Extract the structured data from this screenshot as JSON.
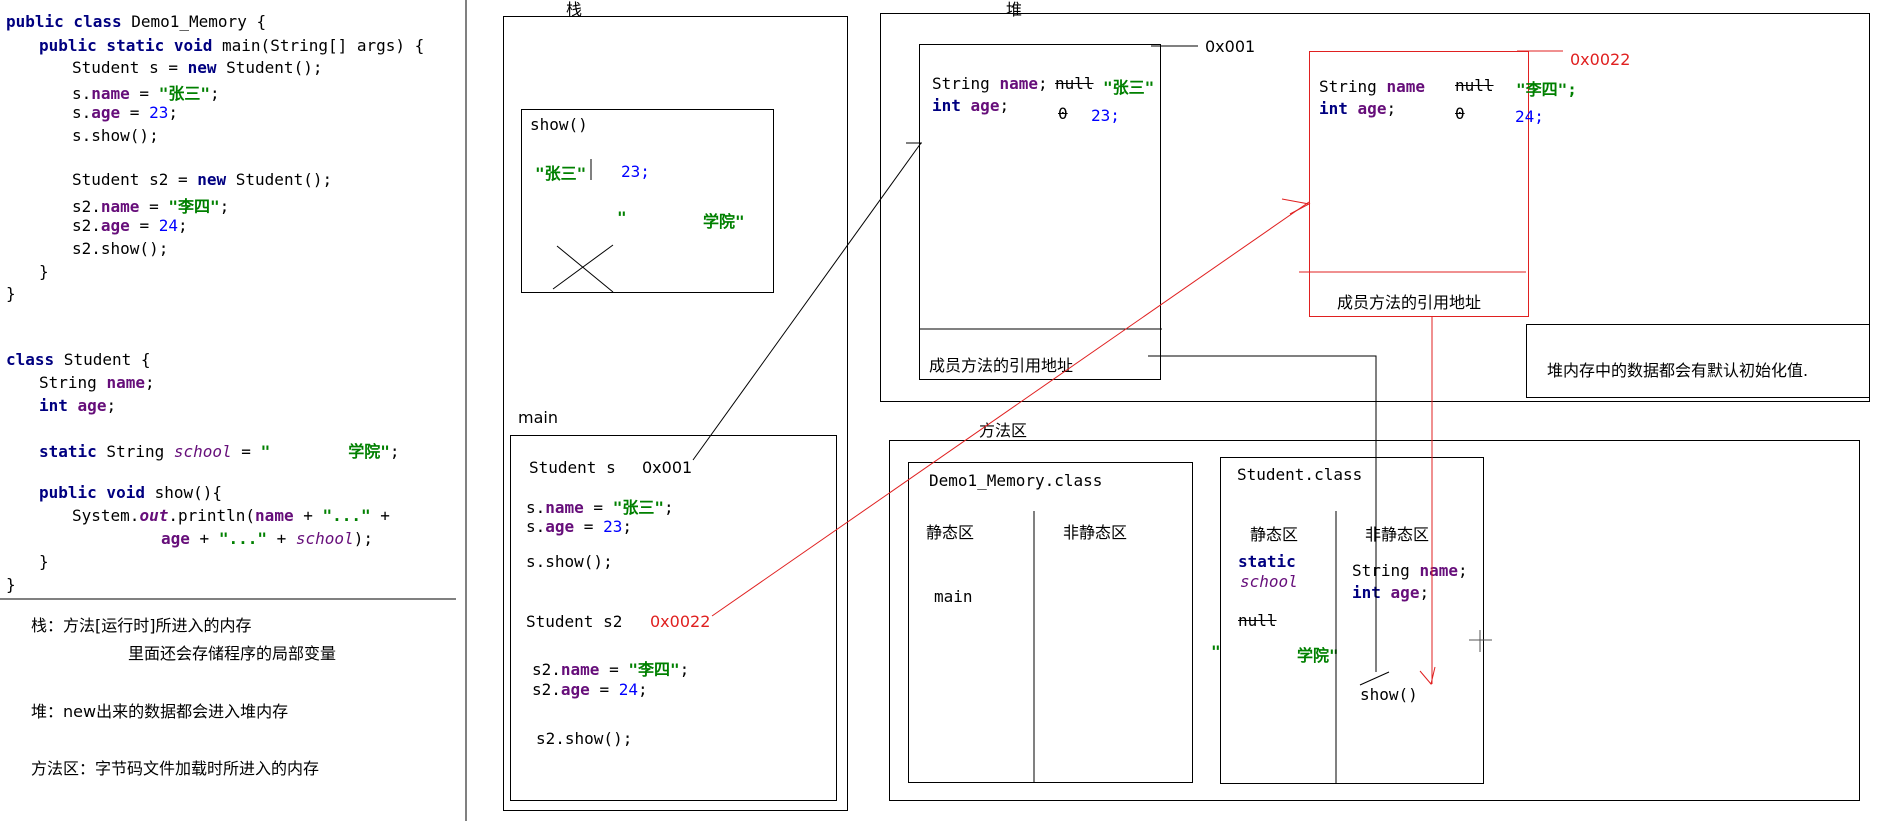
{
  "code": {
    "l1_kw": "public class",
    "l1_rest": " Demo1_Memory {",
    "l2_kw": "public static void",
    "l2_rest": " main(String[] args) {",
    "l3_a": "Student s = ",
    "l3_kw": "new",
    "l3_b": " Student();",
    "l4_a": "s.",
    "l4_fld": "name",
    "l4_b": " = ",
    "l4_str": "\"张三\"",
    "l4_c": ";",
    "l5_a": "s.",
    "l5_fld": "age",
    "l5_b": " = ",
    "l5_num": "23",
    "l5_c": ";",
    "l6": "s.show();",
    "l7_a": "Student s2 = ",
    "l7_kw": "new",
    "l7_b": " Student();",
    "l8_a": "s2.",
    "l8_fld": "name",
    "l8_b": " = ",
    "l8_str": "\"李四\"",
    "l8_c": ";",
    "l9_a": "s2.",
    "l9_fld": "age",
    "l9_b": " = ",
    "l9_num": "24",
    "l9_c": ";",
    "l10": "s2.show();",
    "close1": "}",
    "close2": "}",
    "c1_kw": "class",
    "c1_rest": " Student {",
    "c2_a": "String ",
    "c2_fld": "name",
    "c2_b": ";",
    "c3_kw": "int",
    "c3_sp": " ",
    "c3_fld": "age",
    "c3_b": ";",
    "c4_kw": "static",
    "c4_a": " String ",
    "c4_it": "school",
    "c4_b": " = ",
    "c4_str1": "\"",
    "c4_str2": "学院\"",
    "c4_c": ";",
    "c5_kw": "public void",
    "c5_rest": " show(){",
    "c6_a": "System.",
    "c6_it": "out",
    "c6_b": ".println(",
    "c6_fld": "name",
    "c6_c": " + ",
    "c6_str": "\"...\"",
    "c6_d": " +",
    "c7_fld": "age",
    "c7_a": " + ",
    "c7_str": "\"...\"",
    "c7_b": " + ",
    "c7_it": "school",
    "c7_c": ");",
    "close3": "}",
    "close4": "}"
  },
  "notes": {
    "stack1": "栈：方法[运行时]所进入的内存",
    "stack2": "里面还会存储程序的局部变量",
    "heap": "堆：new出来的数据都会进入堆内存",
    "method": "方法区：字节码文件加载时所进入的内存"
  },
  "stack": {
    "title": "栈",
    "show_frame": {
      "label": "show()",
      "name_val": "\"张三\"",
      "age_val": "23;",
      "school_a": "\"",
      "school_b": "学院\""
    },
    "main_frame": {
      "label": "main",
      "s_decl": "Student s",
      "s_addr": "0x001",
      "s_name_a": "s.",
      "s_name_fld": "name",
      "s_name_b": " = ",
      "s_name_str": "\"张三\"",
      "s_name_c": ";",
      "s_age_a": "s.",
      "s_age_fld": "age",
      "s_age_b": " = ",
      "s_age_num": "23",
      "s_age_c": ";",
      "s_show": "s.show();",
      "s2_decl": "Student s2",
      "s2_addr": "0x0022",
      "s2_name_a": "s2.",
      "s2_name_fld": "name",
      "s2_name_b": " = ",
      "s2_name_str": "\"李四\"",
      "s2_name_c": ";",
      "s2_age_a": "s2.",
      "s2_age_fld": "age",
      "s2_age_b": " = ",
      "s2_age_num": "24",
      "s2_age_c": ";",
      "s2_show": "s2.show();"
    }
  },
  "heap": {
    "title": "堆",
    "obj1": {
      "addr": "0x001",
      "f1_a": "String ",
      "f1_fld": "name",
      "f1_b": ";",
      "f1_null": "null",
      "f1_val": "\"张三\"",
      "f2_kw": "int",
      "f2_sp": " ",
      "f2_fld": "age",
      "f2_b": ";",
      "f2_zero": "0",
      "f2_val": "23;",
      "methods": "成员方法的引用地址"
    },
    "obj2": {
      "addr": "0x0022",
      "f1_a": "String ",
      "f1_fld": "name",
      "f1_null": "null",
      "f1_val": "\"李四\";",
      "f2_kw": "int",
      "f2_sp": " ",
      "f2_fld": "age",
      "f2_b": ";",
      "f2_zero": "0",
      "f2_val": "24;",
      "methods": "成员方法的引用地址"
    },
    "note": "堆内存中的数据都会有默认初始化值."
  },
  "method_area": {
    "title": "方法区",
    "demo": {
      "name": "Demo1_Memory.class",
      "static": "静态区",
      "nonstatic": "非静态区",
      "main": "main"
    },
    "student": {
      "name": "Student.class",
      "static": "静态区",
      "nonstatic": "非静态区",
      "static_kw": "static",
      "static_it": "school",
      "null_text": "null",
      "school_a": "\"",
      "school_b": "学院\"",
      "f1_a": "String ",
      "f1_fld": "name",
      "f1_b": ";",
      "f2_kw": "int",
      "f2_sp": " ",
      "f2_fld": "age",
      "f2_b": ";",
      "show": "show()"
    }
  },
  "colors": {
    "red": "#e02020",
    "keyword": "#000080",
    "field": "#660e7a",
    "string": "#008000",
    "number": "#0000ff"
  }
}
